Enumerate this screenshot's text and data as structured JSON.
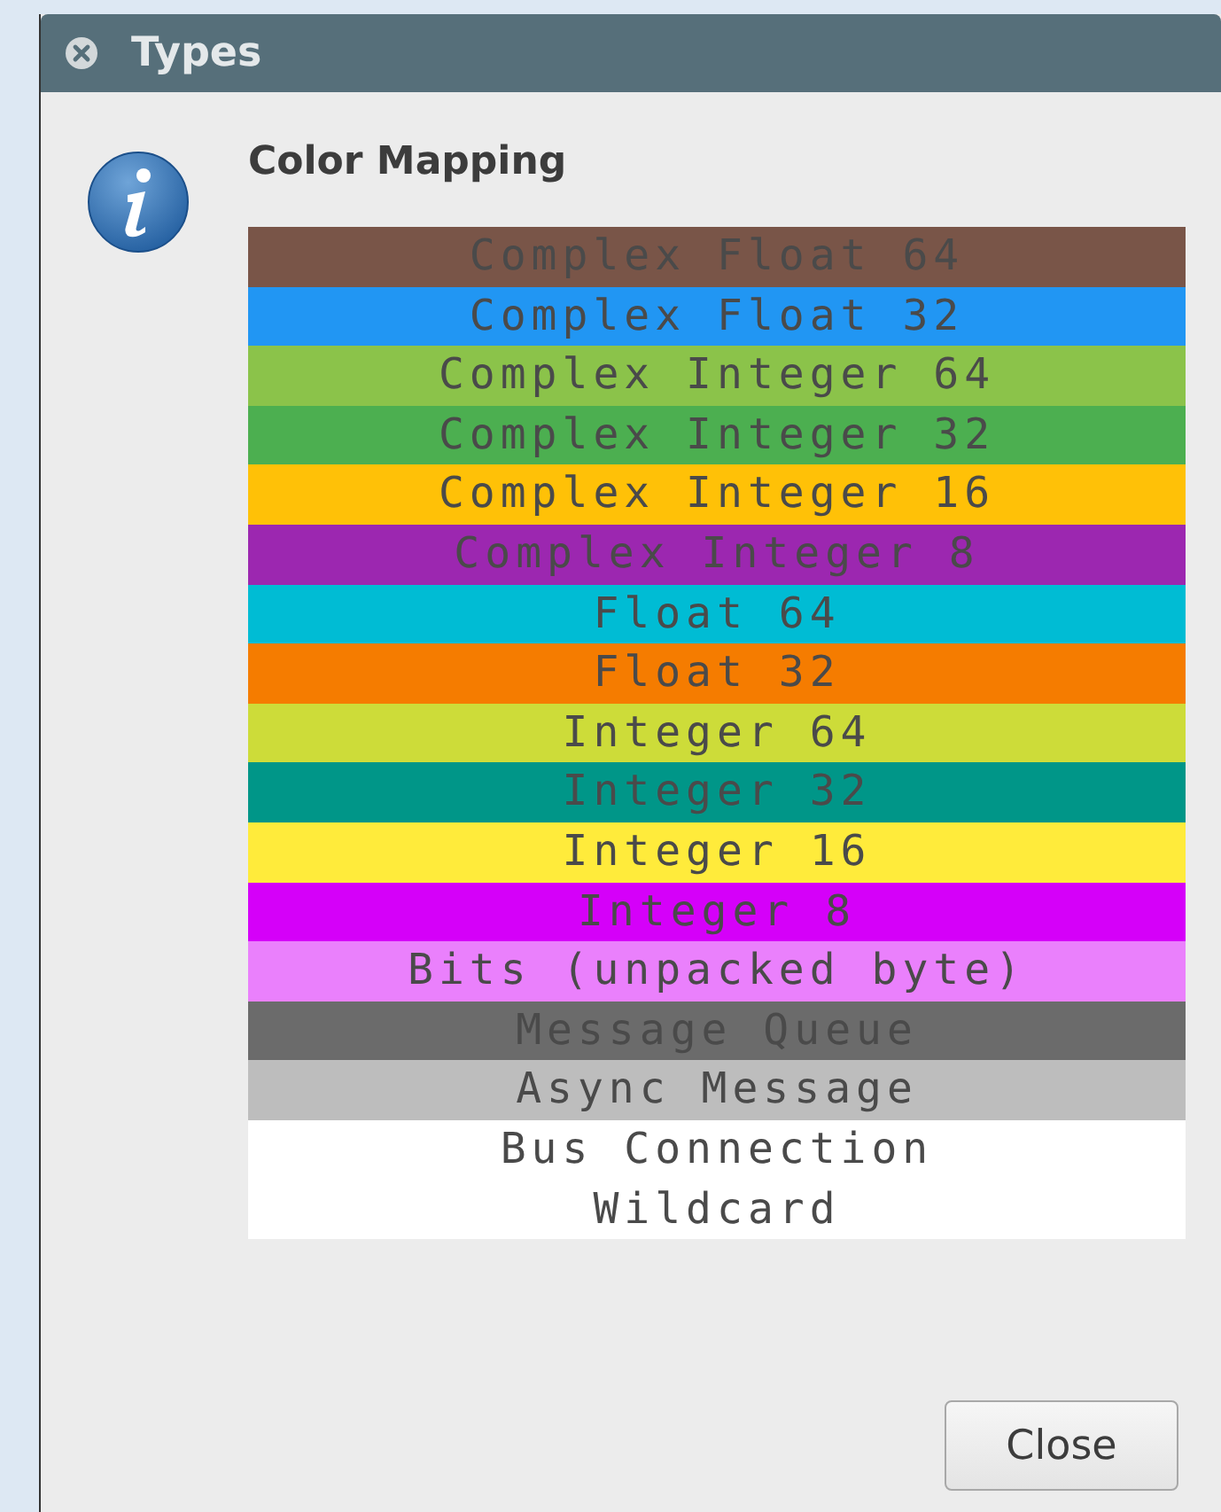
{
  "window": {
    "title": "Types"
  },
  "heading": "Color Mapping",
  "types": [
    {
      "label": "Complex Float 64",
      "color": "#795548"
    },
    {
      "label": "Complex Float 32",
      "color": "#2196f3"
    },
    {
      "label": "Complex Integer 64",
      "color": "#8bc34a"
    },
    {
      "label": "Complex Integer 32",
      "color": "#4caf50"
    },
    {
      "label": "Complex Integer 16",
      "color": "#ffc107"
    },
    {
      "label": "Complex Integer 8",
      "color": "#9c27b0"
    },
    {
      "label": "Float 64",
      "color": "#00bcd4"
    },
    {
      "label": "Float 32",
      "color": "#f57c00"
    },
    {
      "label": "Integer 64",
      "color": "#cddc39"
    },
    {
      "label": "Integer 32",
      "color": "#009688"
    },
    {
      "label": "Integer 16",
      "color": "#ffeb3b"
    },
    {
      "label": "Integer 8",
      "color": "#d500f9"
    },
    {
      "label": "Bits (unpacked byte)",
      "color": "#ea80fc"
    },
    {
      "label": "Message Queue",
      "color": "#6b6b6b"
    },
    {
      "label": "Async Message",
      "color": "#bdbdbd"
    },
    {
      "label": "Bus Connection",
      "color": "#ffffff"
    },
    {
      "label": "Wildcard",
      "color": "#ffffff"
    }
  ],
  "buttons": [
    {
      "label": "Close"
    }
  ]
}
